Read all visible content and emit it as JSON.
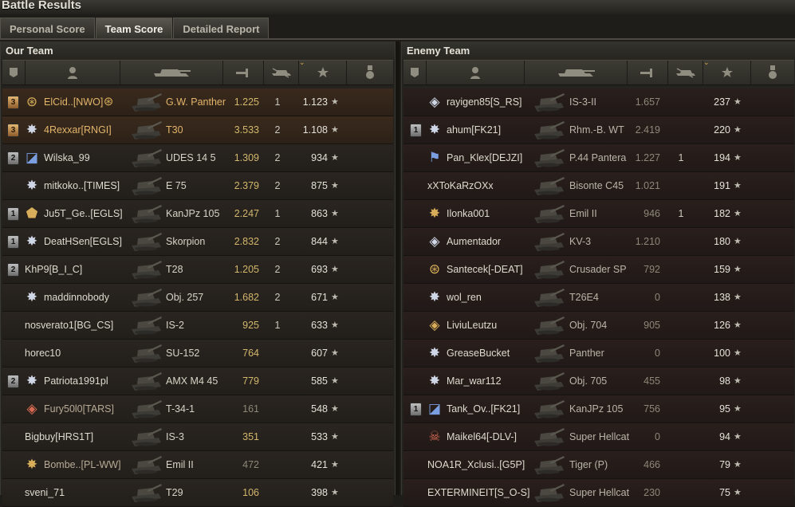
{
  "window": {
    "title": "Battle Results"
  },
  "tabs": [
    {
      "label": "Personal Score",
      "active": false
    },
    {
      "label": "Team Score",
      "active": true
    },
    {
      "label": "Detailed Report",
      "active": false
    }
  ],
  "our_team": {
    "title": "Our Team",
    "columns": [
      "rank-badge-icon",
      "player-icon",
      "tank-icon",
      "damage-icon",
      "kills-icon",
      "experience-star-icon",
      "medal-icon"
    ],
    "rows": [
      {
        "rank": "3",
        "rank_style": "gold",
        "mark": "emblem-icon",
        "mark_glyph": "⊛",
        "mark_color": "gold",
        "name": "ElCid..[NWO]",
        "suffix_glyph": "⊛",
        "tank": "G.W. Panther",
        "damage": "1.225",
        "kills": "1",
        "exp": "1.123",
        "style": "squad hl"
      },
      {
        "rank": "3",
        "rank_style": "gold",
        "mark": "star-emblem-icon",
        "mark_glyph": "✸",
        "mark_color": "white",
        "name": "4Rexxar[RNGI]",
        "tank": "T30",
        "damage": "3.533",
        "kills": "2",
        "exp": "1.108",
        "style": "squad hl"
      },
      {
        "rank": "2",
        "rank_style": "silver",
        "mark": "shield-emblem-icon",
        "mark_glyph": "◪",
        "mark_color": "blue",
        "name": "Wilska_99",
        "tank": "UDES 14 5",
        "damage": "1.309",
        "kills": "2",
        "exp": "934",
        "style": ""
      },
      {
        "rank": "",
        "mark": "star-emblem-icon",
        "mark_glyph": "✸",
        "mark_color": "white",
        "name": "mitkoko..[TIMES]",
        "tank": "E 75",
        "damage": "2.379",
        "kills": "2",
        "exp": "875",
        "style": ""
      },
      {
        "rank": "1",
        "rank_style": "silver",
        "mark": "shield-emblem-icon",
        "mark_glyph": "⬟",
        "mark_color": "gold",
        "name": "Ju5T_Ge..[EGLS]",
        "tank": "KanJPz 105",
        "damage": "2.247",
        "kills": "1",
        "exp": "863",
        "style": ""
      },
      {
        "rank": "1",
        "rank_style": "silver",
        "mark": "star-emblem-icon",
        "mark_glyph": "✸",
        "mark_color": "white",
        "name": "DeatHSen[EGLS]",
        "tank": "Skorpion",
        "damage": "2.832",
        "kills": "2",
        "exp": "844",
        "style": ""
      },
      {
        "rank": "2",
        "rank_style": "silver",
        "mark": "",
        "mark_glyph": "",
        "name": "KhP9[B_I_C]",
        "tank": "T28",
        "damage": "1.205",
        "kills": "2",
        "exp": "693",
        "style": ""
      },
      {
        "rank": "",
        "mark": "star-emblem-icon",
        "mark_glyph": "✸",
        "mark_color": "white",
        "name": "maddinnobody",
        "tank": "Obj. 257",
        "damage": "1.682",
        "kills": "2",
        "exp": "671",
        "style": ""
      },
      {
        "rank": "",
        "mark": "",
        "mark_glyph": "",
        "name": "nosverato1[BG_CS]",
        "tank": "IS-2",
        "damage": "925",
        "kills": "1",
        "exp": "633",
        "style": ""
      },
      {
        "rank": "",
        "mark": "",
        "mark_glyph": "",
        "name": "horec10",
        "tank": "SU-152",
        "damage": "764",
        "kills": "",
        "exp": "607",
        "style": ""
      },
      {
        "rank": "2",
        "rank_style": "silver",
        "mark": "star-emblem-icon",
        "mark_glyph": "✸",
        "mark_color": "white",
        "name": "Patriota1991pl",
        "tank": "AMX M4 45",
        "damage": "779",
        "kills": "",
        "exp": "585",
        "style": ""
      },
      {
        "rank": "",
        "mark": "diamond-emblem-icon",
        "mark_glyph": "◈",
        "mark_color": "red",
        "name": "Fury50l0[TARS]",
        "tank": "T-34-1",
        "damage": "161",
        "damage_style": "grey",
        "kills": "",
        "exp": "548",
        "style": "dim"
      },
      {
        "rank": "",
        "mark": "",
        "mark_glyph": "",
        "name": "Bigbuy[HRS1T]",
        "tank": "IS-3",
        "damage": "351",
        "kills": "",
        "exp": "533",
        "style": ""
      },
      {
        "rank": "",
        "mark": "star-emblem-icon",
        "mark_glyph": "✸",
        "mark_color": "gold",
        "name": "Bombe..[PL-WW]",
        "tank": "Emil II",
        "damage": "472",
        "damage_style": "grey",
        "kills": "",
        "exp": "421",
        "style": "dim"
      },
      {
        "rank": "",
        "mark": "",
        "mark_glyph": "",
        "name": "sveni_71",
        "tank": "T29",
        "damage": "106",
        "kills": "",
        "exp": "398",
        "style": ""
      }
    ]
  },
  "enemy_team": {
    "title": "Enemy Team",
    "rows": [
      {
        "rank": "",
        "mark": "diamond-emblem-icon",
        "mark_glyph": "◈",
        "mark_color": "white",
        "name": "rayigen85[S_RS]",
        "tank": "IS-3-II",
        "damage": "1.657",
        "kills": "",
        "exp": "237"
      },
      {
        "rank": "1",
        "rank_style": "silver",
        "mark": "star-emblem-icon",
        "mark_glyph": "✸",
        "mark_color": "white",
        "name": "ahum[FK21]",
        "tank": "Rhm.-B. WT",
        "damage": "2.419",
        "kills": "",
        "exp": "220"
      },
      {
        "rank": "",
        "mark": "flag-emblem-icon",
        "mark_glyph": "⚑",
        "mark_color": "blue",
        "name": "Pan_Klex[DEJZI]",
        "tank": "P.44 Pantera",
        "damage": "1.227",
        "kills": "1",
        "exp": "194"
      },
      {
        "rank": "",
        "mark": "",
        "mark_glyph": "",
        "name": "xXToKaRzOXx",
        "tank": "Bisonte C45",
        "damage": "1.021",
        "kills": "",
        "exp": "191"
      },
      {
        "rank": "",
        "mark": "star-emblem-icon",
        "mark_glyph": "✸",
        "mark_color": "gold",
        "name": "Ilonka001",
        "tank": "Emil II",
        "damage": "946",
        "kills": "1",
        "exp": "182"
      },
      {
        "rank": "",
        "mark": "diamond-emblem-icon",
        "mark_glyph": "◈",
        "mark_color": "white",
        "name": "Aumentador",
        "tank": "KV-3",
        "damage": "1.210",
        "kills": "",
        "exp": "180"
      },
      {
        "rank": "",
        "mark": "emblem-icon",
        "mark_glyph": "⊛",
        "mark_color": "gold",
        "name": "Santecek[-DEAT]",
        "tank": "Crusader SP",
        "damage": "792",
        "kills": "",
        "exp": "159"
      },
      {
        "rank": "",
        "mark": "star-emblem-icon",
        "mark_glyph": "✸",
        "mark_color": "white",
        "name": "wol_ren",
        "tank": "T26E4",
        "damage": "0",
        "kills": "",
        "exp": "138"
      },
      {
        "rank": "",
        "mark": "diamond-emblem-icon",
        "mark_glyph": "◈",
        "mark_color": "gold",
        "name": "LiviuLeutzu",
        "tank": "Obj. 704",
        "damage": "905",
        "kills": "",
        "exp": "126"
      },
      {
        "rank": "",
        "mark": "star-emblem-icon",
        "mark_glyph": "✸",
        "mark_color": "white",
        "name": "GreaseBucket",
        "tank": "Panther",
        "damage": "0",
        "kills": "",
        "exp": "100"
      },
      {
        "rank": "",
        "mark": "star-emblem-icon",
        "mark_glyph": "✸",
        "mark_color": "white",
        "name": "Mar_war112",
        "tank": "Obj. 705",
        "damage": "455",
        "kills": "",
        "exp": "98"
      },
      {
        "rank": "1",
        "rank_style": "silver",
        "mark": "shield-emblem-icon",
        "mark_glyph": "◪",
        "mark_color": "blue",
        "name": "Tank_Ov..[FK21]",
        "tank": "KanJPz 105",
        "damage": "756",
        "kills": "",
        "exp": "95"
      },
      {
        "rank": "",
        "mark": "skull-emblem-icon",
        "mark_glyph": "☠",
        "mark_color": "red",
        "name": "Maikel64[-DLV-]",
        "tank": "Super Hellcat",
        "damage": "0",
        "kills": "",
        "exp": "94"
      },
      {
        "rank": "",
        "mark": "",
        "mark_glyph": "",
        "name": "NOA1R_Xclusi..[G5P]",
        "tank": "Tiger (P)",
        "damage": "466",
        "kills": "",
        "exp": "79"
      },
      {
        "rank": "",
        "mark": "",
        "mark_glyph": "",
        "name": "EXTERMINEIT[S_O-S]",
        "tank": "Super Hellcat",
        "damage": "230",
        "kills": "",
        "exp": "75"
      }
    ]
  },
  "colors": {
    "accent": "#d8b04a",
    "squad_text": "#e3b56a",
    "background": "#1e1d1a"
  }
}
